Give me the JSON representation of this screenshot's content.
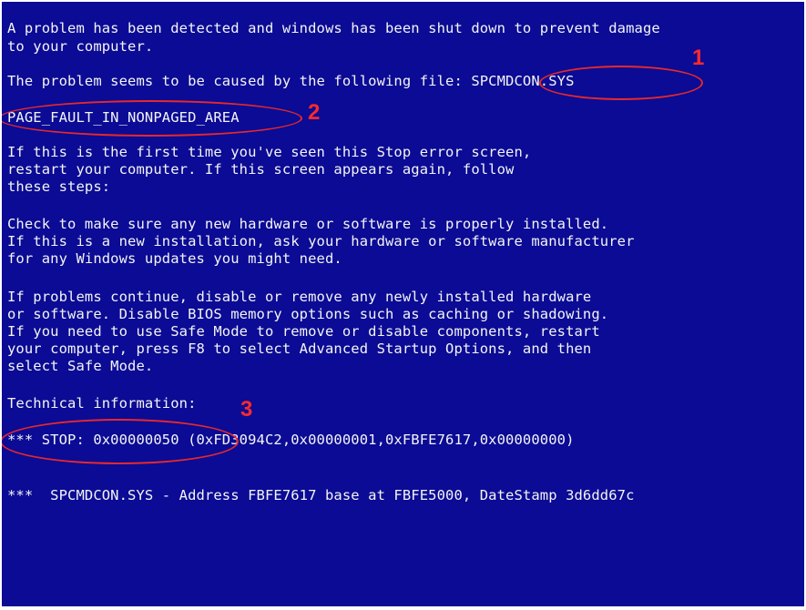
{
  "bsod": {
    "lines": [
      "A problem has been detected and windows has been shut down to prevent damage",
      "to your computer.",
      "The problem seems to be caused by the following file: SPCMDCON.SYS",
      "PAGE_FAULT_IN_NONPAGED_AREA",
      "If this is the first time you've seen this Stop error screen,",
      "restart your computer. If this screen appears again, follow",
      "these steps:",
      "Check to make sure any new hardware or software is properly installed.",
      "If this is a new installation, ask your hardware or software manufacturer",
      "for any Windows updates you might need.",
      "If problems continue, disable or remove any newly installed hardware",
      "or software. Disable BIOS memory options such as caching or shadowing.",
      "If you need to use Safe Mode to remove or disable components, restart",
      "your computer, press F8 to select Advanced Startup Options, and then",
      "select Safe Mode.",
      "Technical information:",
      "*** STOP: 0x00000050 (0xFD3094C2,0x00000001,0xFBFE7617,0x00000000)",
      "***  SPCMDCON.SYS - Address FBFE7617 base at FBFE5000, DateStamp 3d6dd67c"
    ]
  },
  "callouts": {
    "one": "1",
    "two": "2",
    "three": "3"
  },
  "colors": {
    "background": "#0b0b95",
    "text": "#f4f4f4",
    "annotation": "#e8282a"
  }
}
